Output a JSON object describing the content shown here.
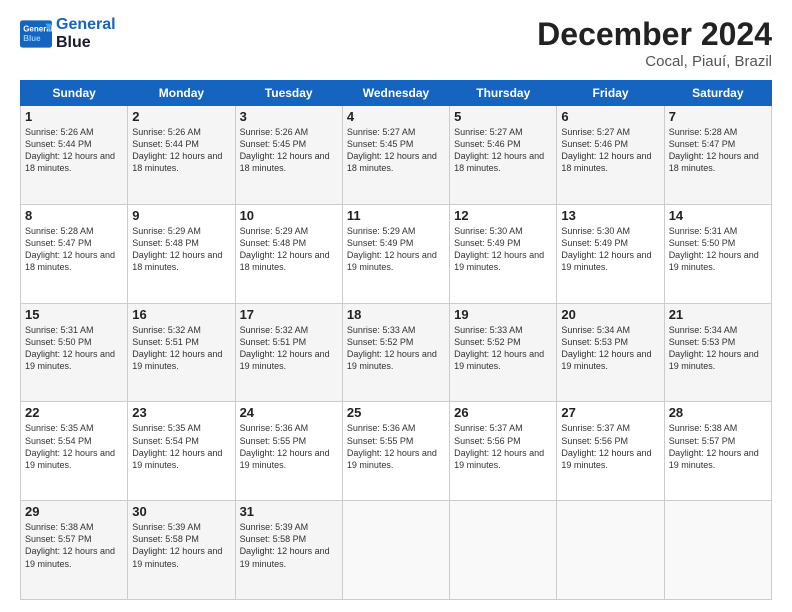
{
  "logo": {
    "line1": "General",
    "line2": "Blue"
  },
  "title": "December 2024",
  "subtitle": "Cocal, Piauí, Brazil",
  "days_of_week": [
    "Sunday",
    "Monday",
    "Tuesday",
    "Wednesday",
    "Thursday",
    "Friday",
    "Saturday"
  ],
  "weeks": [
    [
      {
        "day": 1,
        "sunrise": "5:26 AM",
        "sunset": "5:44 PM",
        "daylight": "12 hours and 18 minutes."
      },
      {
        "day": 2,
        "sunrise": "5:26 AM",
        "sunset": "5:44 PM",
        "daylight": "12 hours and 18 minutes."
      },
      {
        "day": 3,
        "sunrise": "5:26 AM",
        "sunset": "5:45 PM",
        "daylight": "12 hours and 18 minutes."
      },
      {
        "day": 4,
        "sunrise": "5:27 AM",
        "sunset": "5:45 PM",
        "daylight": "12 hours and 18 minutes."
      },
      {
        "day": 5,
        "sunrise": "5:27 AM",
        "sunset": "5:46 PM",
        "daylight": "12 hours and 18 minutes."
      },
      {
        "day": 6,
        "sunrise": "5:27 AM",
        "sunset": "5:46 PM",
        "daylight": "12 hours and 18 minutes."
      },
      {
        "day": 7,
        "sunrise": "5:28 AM",
        "sunset": "5:47 PM",
        "daylight": "12 hours and 18 minutes."
      }
    ],
    [
      {
        "day": 8,
        "sunrise": "5:28 AM",
        "sunset": "5:47 PM",
        "daylight": "12 hours and 18 minutes."
      },
      {
        "day": 9,
        "sunrise": "5:29 AM",
        "sunset": "5:48 PM",
        "daylight": "12 hours and 18 minutes."
      },
      {
        "day": 10,
        "sunrise": "5:29 AM",
        "sunset": "5:48 PM",
        "daylight": "12 hours and 18 minutes."
      },
      {
        "day": 11,
        "sunrise": "5:29 AM",
        "sunset": "5:49 PM",
        "daylight": "12 hours and 19 minutes."
      },
      {
        "day": 12,
        "sunrise": "5:30 AM",
        "sunset": "5:49 PM",
        "daylight": "12 hours and 19 minutes."
      },
      {
        "day": 13,
        "sunrise": "5:30 AM",
        "sunset": "5:49 PM",
        "daylight": "12 hours and 19 minutes."
      },
      {
        "day": 14,
        "sunrise": "5:31 AM",
        "sunset": "5:50 PM",
        "daylight": "12 hours and 19 minutes."
      }
    ],
    [
      {
        "day": 15,
        "sunrise": "5:31 AM",
        "sunset": "5:50 PM",
        "daylight": "12 hours and 19 minutes."
      },
      {
        "day": 16,
        "sunrise": "5:32 AM",
        "sunset": "5:51 PM",
        "daylight": "12 hours and 19 minutes."
      },
      {
        "day": 17,
        "sunrise": "5:32 AM",
        "sunset": "5:51 PM",
        "daylight": "12 hours and 19 minutes."
      },
      {
        "day": 18,
        "sunrise": "5:33 AM",
        "sunset": "5:52 PM",
        "daylight": "12 hours and 19 minutes."
      },
      {
        "day": 19,
        "sunrise": "5:33 AM",
        "sunset": "5:52 PM",
        "daylight": "12 hours and 19 minutes."
      },
      {
        "day": 20,
        "sunrise": "5:34 AM",
        "sunset": "5:53 PM",
        "daylight": "12 hours and 19 minutes."
      },
      {
        "day": 21,
        "sunrise": "5:34 AM",
        "sunset": "5:53 PM",
        "daylight": "12 hours and 19 minutes."
      }
    ],
    [
      {
        "day": 22,
        "sunrise": "5:35 AM",
        "sunset": "5:54 PM",
        "daylight": "12 hours and 19 minutes."
      },
      {
        "day": 23,
        "sunrise": "5:35 AM",
        "sunset": "5:54 PM",
        "daylight": "12 hours and 19 minutes."
      },
      {
        "day": 24,
        "sunrise": "5:36 AM",
        "sunset": "5:55 PM",
        "daylight": "12 hours and 19 minutes."
      },
      {
        "day": 25,
        "sunrise": "5:36 AM",
        "sunset": "5:55 PM",
        "daylight": "12 hours and 19 minutes."
      },
      {
        "day": 26,
        "sunrise": "5:37 AM",
        "sunset": "5:56 PM",
        "daylight": "12 hours and 19 minutes."
      },
      {
        "day": 27,
        "sunrise": "5:37 AM",
        "sunset": "5:56 PM",
        "daylight": "12 hours and 19 minutes."
      },
      {
        "day": 28,
        "sunrise": "5:38 AM",
        "sunset": "5:57 PM",
        "daylight": "12 hours and 19 minutes."
      }
    ],
    [
      {
        "day": 29,
        "sunrise": "5:38 AM",
        "sunset": "5:57 PM",
        "daylight": "12 hours and 19 minutes."
      },
      {
        "day": 30,
        "sunrise": "5:39 AM",
        "sunset": "5:58 PM",
        "daylight": "12 hours and 19 minutes."
      },
      {
        "day": 31,
        "sunrise": "5:39 AM",
        "sunset": "5:58 PM",
        "daylight": "12 hours and 19 minutes."
      },
      null,
      null,
      null,
      null
    ]
  ]
}
